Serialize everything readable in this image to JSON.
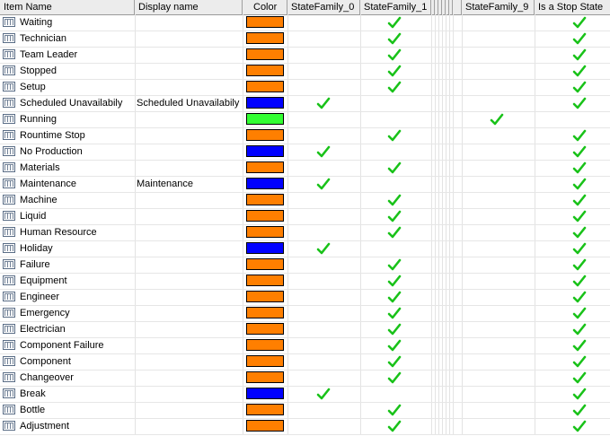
{
  "columns": {
    "item_name": "Item Name",
    "display_name": "Display name",
    "color": "Color",
    "sf0": "StateFamily_0",
    "sf1": "StateFamily_1",
    "sf9": "StateFamily_9",
    "stop": "Is a Stop State"
  },
  "colors": {
    "orange": "#ff7f00",
    "blue": "#0000ff",
    "green": "#33ff33",
    "check": "#19c219"
  },
  "rows": [
    {
      "name": "Waiting",
      "display": "",
      "color": "orange",
      "sf0": false,
      "sf1": true,
      "sf9": false,
      "stop": true
    },
    {
      "name": "Technician",
      "display": "",
      "color": "orange",
      "sf0": false,
      "sf1": true,
      "sf9": false,
      "stop": true
    },
    {
      "name": "Team Leader",
      "display": "",
      "color": "orange",
      "sf0": false,
      "sf1": true,
      "sf9": false,
      "stop": true
    },
    {
      "name": "Stopped",
      "display": "",
      "color": "orange",
      "sf0": false,
      "sf1": true,
      "sf9": false,
      "stop": true
    },
    {
      "name": "Setup",
      "display": "",
      "color": "orange",
      "sf0": false,
      "sf1": true,
      "sf9": false,
      "stop": true
    },
    {
      "name": "Scheduled Unavailabily",
      "display": "Scheduled Unavailabily",
      "color": "blue",
      "sf0": true,
      "sf1": false,
      "sf9": false,
      "stop": true
    },
    {
      "name": "Running",
      "display": "",
      "color": "green",
      "sf0": false,
      "sf1": false,
      "sf9": true,
      "stop": false
    },
    {
      "name": "Rountime Stop",
      "display": "",
      "color": "orange",
      "sf0": false,
      "sf1": true,
      "sf9": false,
      "stop": true
    },
    {
      "name": "No Production",
      "display": "",
      "color": "blue",
      "sf0": true,
      "sf1": false,
      "sf9": false,
      "stop": true
    },
    {
      "name": "Materials",
      "display": "",
      "color": "orange",
      "sf0": false,
      "sf1": true,
      "sf9": false,
      "stop": true
    },
    {
      "name": "Maintenance",
      "display": "Maintenance",
      "color": "blue",
      "sf0": true,
      "sf1": false,
      "sf9": false,
      "stop": true
    },
    {
      "name": "Machine",
      "display": "",
      "color": "orange",
      "sf0": false,
      "sf1": true,
      "sf9": false,
      "stop": true
    },
    {
      "name": "Liquid",
      "display": "",
      "color": "orange",
      "sf0": false,
      "sf1": true,
      "sf9": false,
      "stop": true
    },
    {
      "name": "Human Resource",
      "display": "",
      "color": "orange",
      "sf0": false,
      "sf1": true,
      "sf9": false,
      "stop": true
    },
    {
      "name": "Holiday",
      "display": "",
      "color": "blue",
      "sf0": true,
      "sf1": false,
      "sf9": false,
      "stop": true
    },
    {
      "name": "Failure",
      "display": "",
      "color": "orange",
      "sf0": false,
      "sf1": true,
      "sf9": false,
      "stop": true
    },
    {
      "name": "Equipment",
      "display": "",
      "color": "orange",
      "sf0": false,
      "sf1": true,
      "sf9": false,
      "stop": true
    },
    {
      "name": "Engineer",
      "display": "",
      "color": "orange",
      "sf0": false,
      "sf1": true,
      "sf9": false,
      "stop": true
    },
    {
      "name": "Emergency",
      "display": "",
      "color": "orange",
      "sf0": false,
      "sf1": true,
      "sf9": false,
      "stop": true
    },
    {
      "name": "Electrician",
      "display": "",
      "color": "orange",
      "sf0": false,
      "sf1": true,
      "sf9": false,
      "stop": true
    },
    {
      "name": "Component Failure",
      "display": "",
      "color": "orange",
      "sf0": false,
      "sf1": true,
      "sf9": false,
      "stop": true
    },
    {
      "name": "Component",
      "display": "",
      "color": "orange",
      "sf0": false,
      "sf1": true,
      "sf9": false,
      "stop": true
    },
    {
      "name": "Changeover",
      "display": "",
      "color": "orange",
      "sf0": false,
      "sf1": true,
      "sf9": false,
      "stop": true
    },
    {
      "name": "Break",
      "display": "",
      "color": "blue",
      "sf0": true,
      "sf1": false,
      "sf9": false,
      "stop": true
    },
    {
      "name": "Bottle",
      "display": "",
      "color": "orange",
      "sf0": false,
      "sf1": true,
      "sf9": false,
      "stop": true
    },
    {
      "name": "Adjustment",
      "display": "",
      "color": "orange",
      "sf0": false,
      "sf1": true,
      "sf9": false,
      "stop": true
    }
  ]
}
